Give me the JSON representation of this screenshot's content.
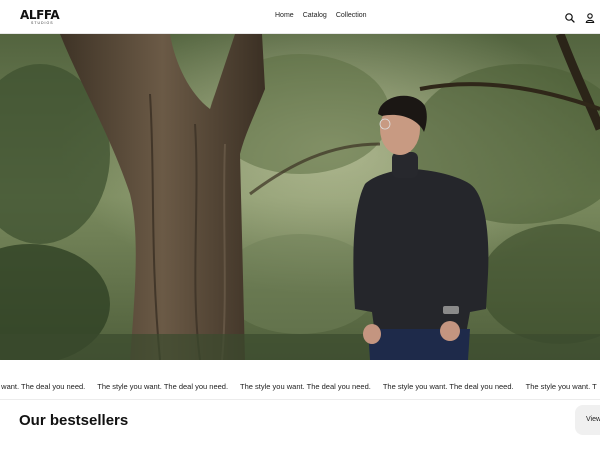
{
  "header": {
    "logo": "ALFFA",
    "logo_sub": "STUDIOS",
    "nav": [
      "Home",
      "Catalog",
      "Collection"
    ],
    "icons": [
      "search-icon",
      "account-icon"
    ]
  },
  "marquee": {
    "items": [
      "you want. The deal you need.",
      "The style you want. The deal you need.",
      "The style you want. The deal you need.",
      "The style you want. The deal you need.",
      "The style you want. T"
    ]
  },
  "bestsellers": {
    "title": "Our bestsellers",
    "view_all": "View all"
  },
  "colors": {
    "accent": "#111111",
    "button_bg": "#f0f0f0"
  }
}
